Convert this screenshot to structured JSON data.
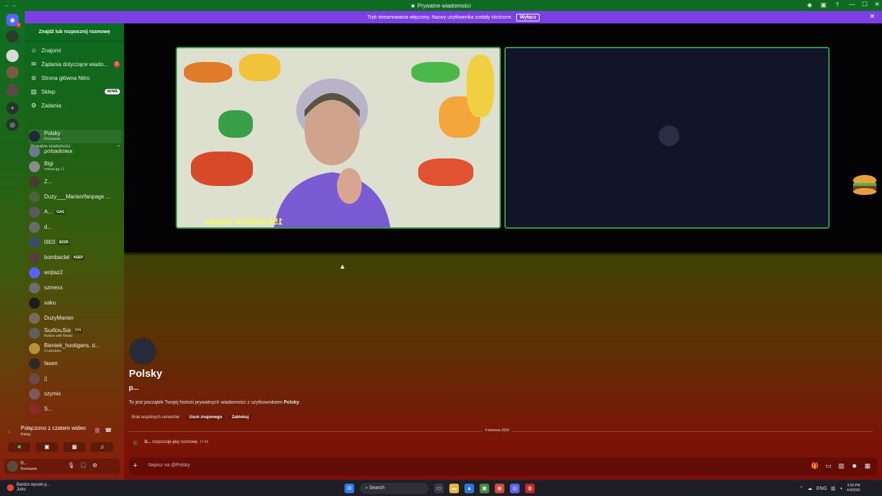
{
  "window": {
    "title": "Prywatne wiadomości",
    "title_icon": "discord-icon",
    "controls": [
      "—",
      "☐",
      "✕"
    ]
  },
  "banner": {
    "text": "Tryb streamowania włączony. Nazwy użytkownika zostały skrócone.",
    "button": "Wyłącz",
    "close": "✕"
  },
  "sidebar": {
    "find": "Znajdź lub rozpocznij rozmowę",
    "nav": [
      {
        "label": "Znajomi",
        "icon": "friends-icon"
      },
      {
        "label": "Żądania dotyczące wiado...",
        "icon": "mail-icon",
        "badge": "5"
      },
      {
        "label": "Strona główna Nitro",
        "icon": "nitro-icon"
      },
      {
        "label": "Sklep",
        "icon": "shop-icon",
        "tag": "NOWE"
      },
      {
        "label": "Zadania",
        "icon": "quests-icon"
      }
    ],
    "dm_header": "Prywatne wiadomości",
    "dm_add": "+",
    "dms": [
      {
        "name": "Polsky",
        "sub": "Rozmawia"
      },
      {
        "name": "ρσℓαк∂σяєк",
        "sub": ""
      },
      {
        "name": "Bigi",
        "sub": "onbeat.gg +1"
      },
      {
        "name": "Z...",
        "sub": ""
      },
      {
        "name": "Duzy___Marian/fanpage ...",
        "sub": ""
      },
      {
        "name": "A...",
        "sub": "",
        "tag": "GAG"
      },
      {
        "name": "d...",
        "sub": ""
      },
      {
        "name": "0ĪƐ0",
        "sub": "",
        "tag": "BZZR"
      },
      {
        "name": "bombaclat",
        "sub": "",
        "tag": "KEEP"
      },
      {
        "name": "wojtaz2",
        "sub": ""
      },
      {
        "name": "szmexx",
        "sub": ""
      },
      {
        "name": "xaku",
        "sub": ""
      },
      {
        "name": "DuzyMarian",
        "sub": ""
      },
      {
        "name": "SωιƭcԋՏαι",
        "sub": "Roblox with Medal",
        "tag": "???"
      },
      {
        "name": "Bieniek_hooligans, d...",
        "sub": "3 członków"
      },
      {
        "name": "faxen",
        "sub": ""
      },
      {
        "name": "▯",
        "sub": ""
      },
      {
        "name": "szymix",
        "sub": ""
      },
      {
        "name": "S...",
        "sub": ""
      }
    ],
    "voice": {
      "title": "Połączono z czatem wideo",
      "sub": "Polsky"
    },
    "user": {
      "name": "0...",
      "status": "Rozmawia"
    }
  },
  "call": {
    "cam_text": "156 dzikich wypite"
  },
  "chat": {
    "name": "Polsky",
    "username": "p...",
    "intro_prefix": "To jest początek Twojej historii prywatnych wiadomości z użytkownikiem ",
    "intro_name": "Polsky",
    "intro_suffix": ".",
    "no_servers": "Brak wspólnych serwerów",
    "remove_friend": "Usuń znajomego",
    "block": "Zablokuj",
    "date": "4 kwietnia 2026",
    "call_msg_user": "D...",
    "call_msg": "rozpoczął(-ęła) rozmowę.",
    "call_msg_time": "17:49",
    "placeholder": "Napisz na @Polsky"
  },
  "taskbar": {
    "weather_title": "Bardzo wysoki p...",
    "weather_sub": "Jutro",
    "search": "Search",
    "lang": "ENG",
    "time": "5:56 PM",
    "date": "4/4/2026"
  }
}
